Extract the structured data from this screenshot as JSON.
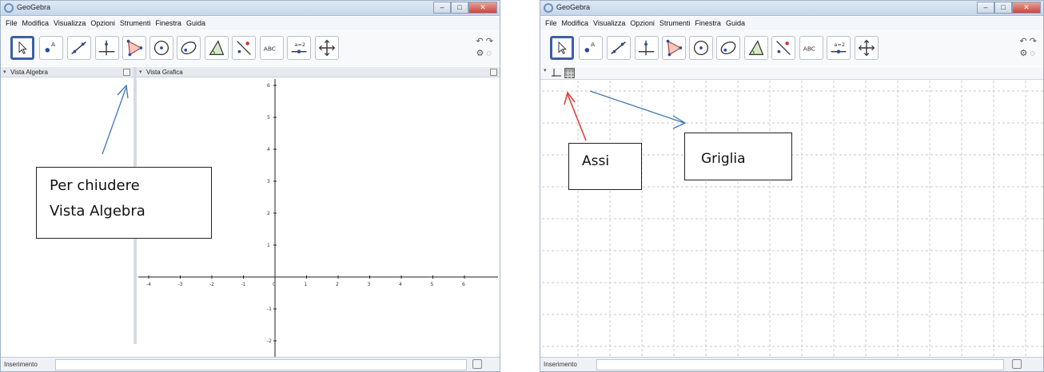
{
  "left": {
    "app_title": "GeoGebra",
    "menu": [
      "File",
      "Modifica",
      "Visualizza",
      "Opzioni",
      "Strumenti",
      "Finestra",
      "Guida"
    ],
    "tools": [
      "move-tool",
      "point-tool",
      "line-tool",
      "perpendicular-tool",
      "polygon-tool",
      "circle-tool",
      "conic-tool",
      "angle-tool",
      "reflect-tool",
      "text-tool",
      "slider-tool",
      "move-view-tool"
    ],
    "tool_text_label": "ABC",
    "slider_label": "a=2",
    "algebra_view_title": "Vista Algebra",
    "graphics_view_title": "Vista Grafica",
    "x_ticks": [
      "-4",
      "-3",
      "-2",
      "-1",
      "0",
      "1",
      "2",
      "3",
      "4",
      "5",
      "6"
    ],
    "y_ticks": [
      "6",
      "5",
      "4",
      "3",
      "2",
      "1",
      "-1",
      "-2"
    ],
    "input_label": "Inserimento",
    "annotation": {
      "line1": "Per chiudere",
      "line2": "Vista Algebra"
    }
  },
  "right": {
    "app_title": "GeoGebra",
    "menu": [
      "File",
      "Modifica",
      "Visualizza",
      "Opzioni",
      "Strumenti",
      "Finestra",
      "Guida"
    ],
    "tool_text_label": "ABC",
    "slider_label": "a=2",
    "input_label": "Inserimento",
    "annotation_axes": "Assi",
    "annotation_grid": "Griglia"
  },
  "colors": {
    "arrow_blue": "#3f78b4",
    "arrow_red": "#d9443a",
    "selected_tool_border": "#3d5fa6"
  }
}
